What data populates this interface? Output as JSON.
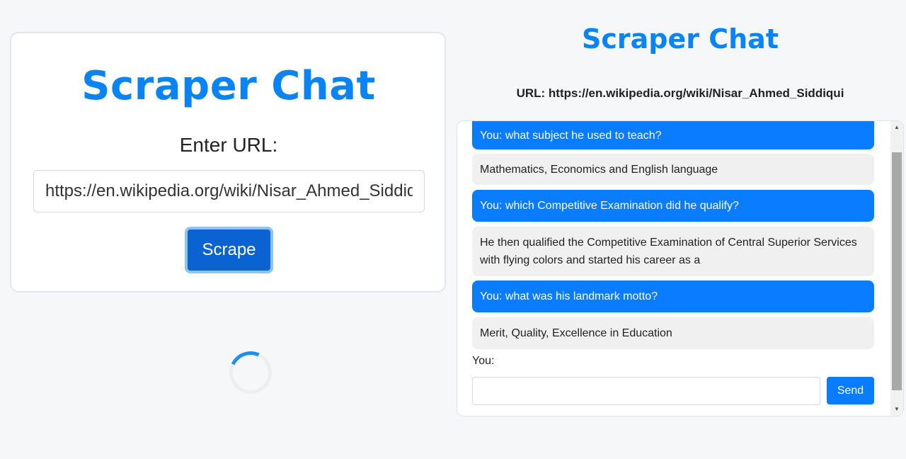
{
  "scraper_panel": {
    "title": "Scraper Chat",
    "enter_label": "Enter URL:",
    "url_value": "https://en.wikipedia.org/wiki/Nisar_Ahmed_Siddiqui",
    "scrape_label": "Scrape"
  },
  "chat_panel": {
    "title": "Scraper Chat",
    "url_text": "URL: https://en.wikipedia.org/wiki/Nisar_Ahmed_Siddiqui",
    "messages": [
      {
        "role": "user",
        "text": "You: what subject he used to teach?"
      },
      {
        "role": "bot",
        "text": "Mathematics, Economics and English language"
      },
      {
        "role": "user",
        "text": "You: which Competitive Examination did he qualify?"
      },
      {
        "role": "bot",
        "text": "He then qualified the Competitive Examination of Central Superior Services with flying colors and started his career as a"
      },
      {
        "role": "user",
        "text": "You: what was his landmark motto?"
      },
      {
        "role": "bot",
        "text": "Merit, Quality, Excellence in Education"
      }
    ],
    "you_label": "You:",
    "input_value": "",
    "send_label": "Send"
  },
  "icons": {
    "spinner": "loading-spinner",
    "scroll_up": "triangle-up",
    "scroll_down": "triangle-down"
  },
  "colors": {
    "accent": "#0a84f5",
    "user_bubble": "#0a7cff",
    "bot_bubble": "#f0f0f1",
    "scrape_button": "#0b62d1"
  }
}
